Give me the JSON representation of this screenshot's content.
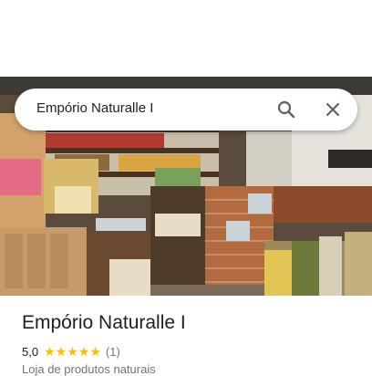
{
  "search": {
    "query": "Empório Naturalle I"
  },
  "place": {
    "name": "Empório Naturalle I",
    "rating": "5,0",
    "stars_filled": 5,
    "review_count": "(1)",
    "category": "Loja de produtos naturais"
  },
  "colors": {
    "star": "#fbbc04",
    "text_primary": "#202124",
    "text_secondary": "#70757a"
  }
}
